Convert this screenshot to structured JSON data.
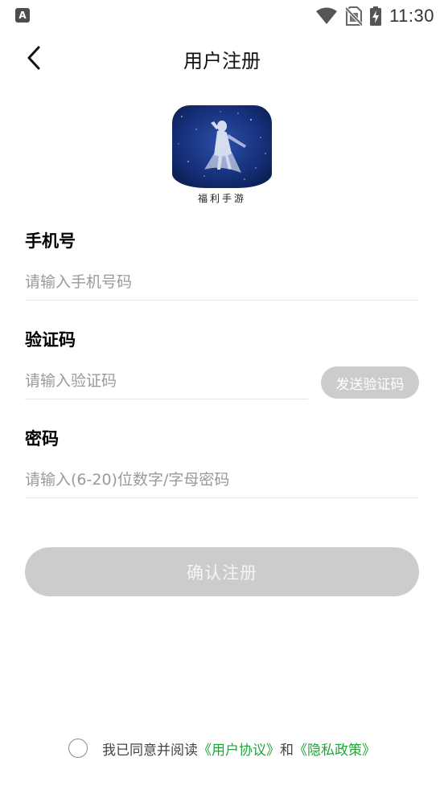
{
  "status_bar": {
    "time": "11:30",
    "app_icon": "a-icon",
    "icons": [
      "wifi-icon",
      "no-sim-icon",
      "battery-charging-icon"
    ]
  },
  "header": {
    "back_icon": "back-chevron-icon",
    "title": "用户注册"
  },
  "logo": {
    "caption": "福利手游"
  },
  "form": {
    "phone": {
      "label": "手机号",
      "placeholder": "请输入手机号码",
      "value": ""
    },
    "code": {
      "label": "验证码",
      "placeholder": "请输入验证码",
      "value": "",
      "send_button": "发送验证码"
    },
    "password": {
      "label": "密码",
      "placeholder": "请输入(6-20)位数字/字母密码",
      "value": ""
    },
    "submit_label": "确认注册"
  },
  "agreement": {
    "prefix": "我已同意并阅读",
    "user_agreement": "《用户协议》",
    "and": "和",
    "privacy_policy": "《隐私政策》",
    "checked": false
  },
  "colors": {
    "link": "#21a53a",
    "disabled_button": "#cccccc",
    "divider": "#e5e5e5",
    "placeholder": "#9a9a9a"
  }
}
